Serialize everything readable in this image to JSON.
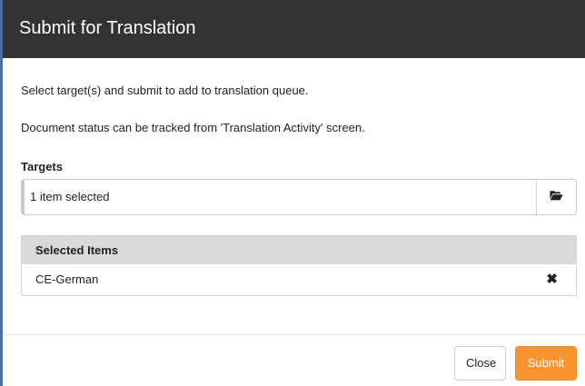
{
  "dialog": {
    "title": "Submit for Translation",
    "message_line1": "Select target(s) and submit to add to translation queue.",
    "message_line2": "Document status can be tracked from 'Translation Activity' screen."
  },
  "targets": {
    "label": "Targets",
    "value": "1 item selected",
    "browse_icon": "folder-open-icon"
  },
  "selected_items": {
    "header": "Selected Items",
    "items": [
      {
        "label": "CE-German",
        "remove_icon": "close-icon",
        "remove_glyph": "✖"
      }
    ]
  },
  "footer": {
    "close_label": "Close",
    "submit_label": "Submit"
  },
  "colors": {
    "header_bg": "#333333",
    "submit_bg": "#f79431",
    "panel_header_bg": "#d9d9d9",
    "left_accent": "#4a6fa5"
  }
}
